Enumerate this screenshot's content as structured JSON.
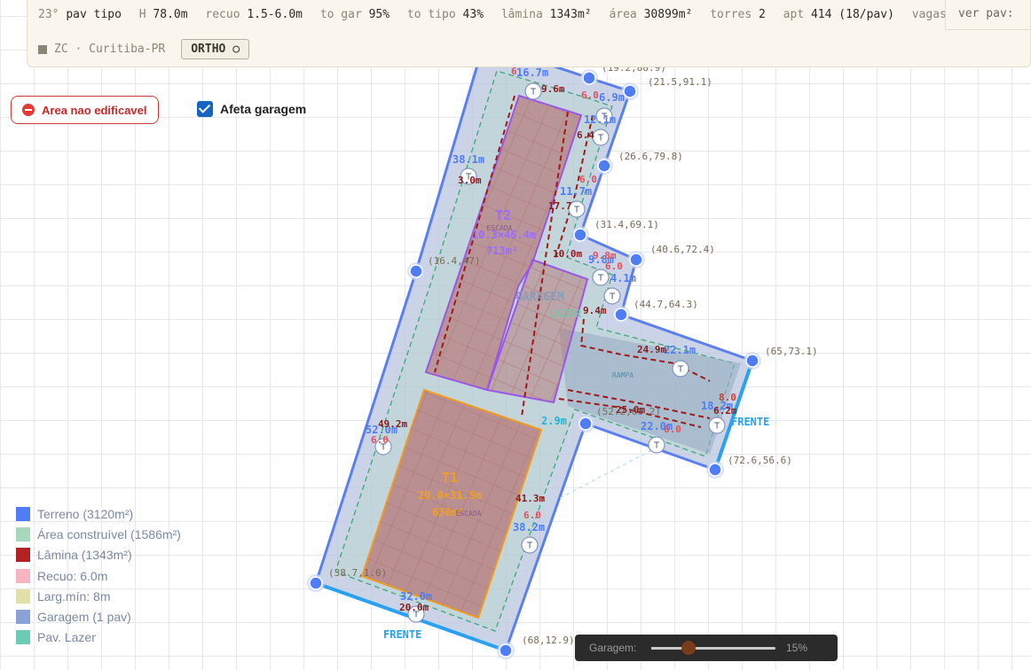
{
  "stats": [
    {
      "label": "23°",
      "value": "pav tipo"
    },
    {
      "label": "H",
      "value": "78.0m"
    },
    {
      "label": "recuo",
      "value": "1.5-6.0m"
    },
    {
      "label": "to gar",
      "value": "95%"
    },
    {
      "label": "to tipo",
      "value": "43%"
    },
    {
      "label": "lâmina",
      "value": "1343m²"
    },
    {
      "label": "área",
      "value": "30899m²"
    },
    {
      "label": "torres",
      "value": "2"
    },
    {
      "label": "apt",
      "value": "414 (18/pav)"
    },
    {
      "label": "vagas",
      "value": ""
    }
  ],
  "ver_pav_label": "ver pav:",
  "zone": "ZC · Curitiba-PR",
  "ortho_label": "ORTHO ○",
  "area_button_label": "Area nao edificavel",
  "garage_checkbox": {
    "label": "Afeta garagem",
    "checked": true
  },
  "legend": [
    {
      "label": "Terreno (3120m²)",
      "color": "#4f7cf7"
    },
    {
      "label": "Área construível (1586m²)",
      "color": "#a8d8b9"
    },
    {
      "label": "Lâmina (1343m²)",
      "color": "#b22222"
    },
    {
      "label": "Recuo: 6.0m",
      "color": "#f7b5c0"
    },
    {
      "label": "Larg.mín: 8m",
      "color": "#e2e0a8"
    },
    {
      "label": "Garagem (1 pav)",
      "color": "#8aa2d6"
    },
    {
      "label": "Pav. Lazer",
      "color": "#6ccbb5"
    }
  ],
  "slider": {
    "label": "Garagem:",
    "value_label": "15%",
    "fraction": 0.3
  },
  "towers": [
    {
      "name": "T1",
      "dims": "20.0×31.5m",
      "area": "630m²",
      "sub": "ESCADA"
    },
    {
      "name": "T2",
      "dims": "10.3×46.4m",
      "area": "713m²",
      "sub": "ESCADA"
    }
  ],
  "vertex_coords": [
    "(19.2,88.9)",
    "(21.5,91.1)",
    "(26.6,79.8)",
    "(31.4,69.1)",
    "(40.6,72.4)",
    "(44.7,64.3)",
    "(65,73.1)",
    "(72.6,56.6)",
    "(52.2,60.2)",
    "(16.4,47)",
    "(38.7,1.0)",
    "(68,12.9)"
  ],
  "edge_lengths": [
    "16.7m",
    "6.9m",
    "12.1m",
    "11.7m",
    "9.8m",
    "4.1m",
    "22.1m",
    "18.2m",
    "22.0m",
    "2.9m",
    "38.2m",
    "32.0m",
    "52.0m",
    "38.1m"
  ],
  "dims_red": [
    "6",
    "9.6m",
    "6.0",
    "6.4",
    "6.0",
    "3.0m",
    "17.7",
    "10.0m",
    "9.8m",
    "6.0",
    "9.4m",
    "24.9m",
    "25.0m",
    "6.0",
    "8.0",
    "6.2m",
    "49.2m",
    "6.0",
    "41.3m",
    "6.0",
    "20.0m"
  ],
  "frente_labels": [
    "FRENTE",
    "FRENTE"
  ],
  "garage_text": "GARAGEM",
  "lazer_text": "LAZER",
  "rampa_text": "RAMPA"
}
